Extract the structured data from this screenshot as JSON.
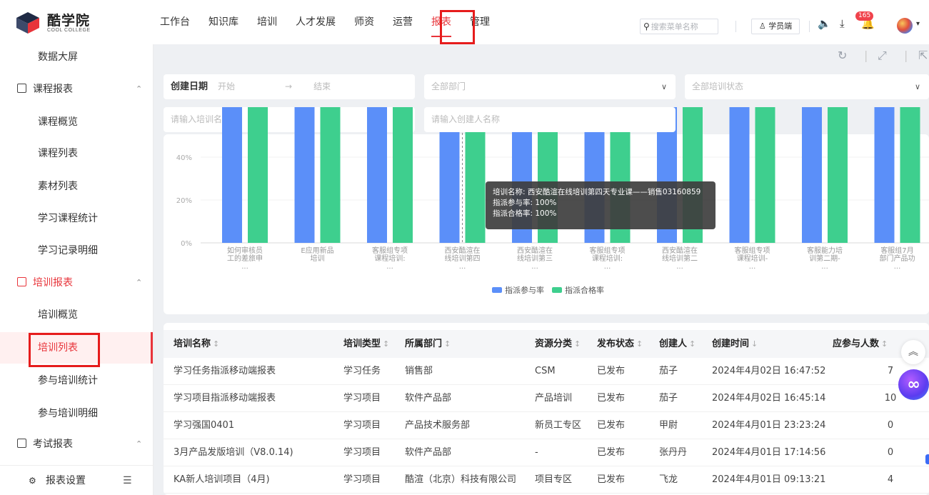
{
  "app": {
    "name": "酷学院",
    "sub": "COOL COLLEGE"
  },
  "nav": [
    {
      "label": "工作台"
    },
    {
      "label": "知识库"
    },
    {
      "label": "培训"
    },
    {
      "label": "人才发展"
    },
    {
      "label": "师资"
    },
    {
      "label": "运营"
    },
    {
      "label": "报表",
      "active": true
    },
    {
      "label": "管理"
    }
  ],
  "header": {
    "search_placeholder": "搜索菜单名称",
    "role_label": "学员端",
    "notification_count": "165"
  },
  "sidebar": {
    "items": [
      {
        "label": "数据大屏",
        "type": "sub"
      },
      {
        "label": "课程报表",
        "type": "group"
      },
      {
        "label": "课程概览",
        "type": "sub"
      },
      {
        "label": "课程列表",
        "type": "sub"
      },
      {
        "label": "素材列表",
        "type": "sub"
      },
      {
        "label": "学习课程统计",
        "type": "sub"
      },
      {
        "label": "学习记录明细",
        "type": "sub"
      },
      {
        "label": "培训报表",
        "type": "group",
        "active": true
      },
      {
        "label": "培训概览",
        "type": "sub"
      },
      {
        "label": "培训列表",
        "type": "sub",
        "active": true
      },
      {
        "label": "参与培训统计",
        "type": "sub"
      },
      {
        "label": "参与培训明细",
        "type": "sub"
      },
      {
        "label": "考试报表",
        "type": "group"
      }
    ],
    "settings_label": "报表设置"
  },
  "filters": {
    "date_label": "创建日期",
    "date_start": "开始",
    "date_end": "结束",
    "department": "全部部门",
    "status": "全部培训状态",
    "name_placeholder": "请输入培训名称",
    "creator_placeholder": "请输入创建人名称"
  },
  "chart_data": {
    "type": "bar",
    "categories": [
      "如何审核员工的差旅申...",
      "E应用新品培训",
      "客服组专项课程培训:...",
      "西安酷渲在线培训第四...",
      "西安酷渲在线培训第三...",
      "客服组专项课程培训:...",
      "西安酷渲在线培训第二...",
      "客服组专项课程培训-...",
      "客服能力培训第二期-...",
      "客服组7月部门产品功..."
    ],
    "tick_lines": [
      [
        "如何审核员",
        "工的差旅申",
        "..."
      ],
      [
        "E应用新品",
        "培训",
        ""
      ],
      [
        "客服组专项",
        "课程培训:",
        "..."
      ],
      [
        "西安酷渲在",
        "线培训第四",
        "..."
      ],
      [
        "西安酷渲在",
        "线培训第三",
        "..."
      ],
      [
        "客服组专项",
        "课程培训:",
        "..."
      ],
      [
        "西安酷渲在",
        "线培训第二",
        "..."
      ],
      [
        "客服组专项",
        "课程培训-",
        "..."
      ],
      [
        "客服能力培",
        "训第二期-",
        "..."
      ],
      [
        "客服组7月",
        "部门产品功",
        "..."
      ]
    ],
    "series": [
      {
        "name": "指派参与率",
        "color": "#5b8ff9",
        "values": [
          100,
          100,
          100,
          100,
          100,
          100,
          100,
          100,
          100,
          100
        ]
      },
      {
        "name": "指派合格率",
        "color": "#3ecf8e",
        "values": [
          100,
          100,
          100,
          100,
          100,
          100,
          100,
          100,
          100,
          100
        ]
      }
    ],
    "y_ticks": [
      "0%",
      "20%",
      "40%"
    ],
    "ylim": [
      0,
      100
    ],
    "legend": "bottom-center"
  },
  "tooltip": {
    "line1": "培训名称: 西安酷渲在线培训第四天专业课——销售03160859",
    "line2": "指派参与率: 100%",
    "line3": "指派合格率: 100%"
  },
  "table": {
    "columns": [
      "培训名称",
      "培训类型",
      "所属部门",
      "资源分类",
      "发布状态",
      "创建人",
      "创建时间",
      "应参与人数"
    ],
    "rows": [
      [
        "学习任务指派移动端报表",
        "学习任务",
        "销售部",
        "CSM",
        "已发布",
        "茄子",
        "2024年4月02日 16:47:52",
        "7"
      ],
      [
        "学习项目指派移动端报表",
        "学习项目",
        "软件产品部",
        "产品培训",
        "已发布",
        "茄子",
        "2024年4月02日 16:45:14",
        "10"
      ],
      [
        "学习强国0401",
        "学习项目",
        "产品技术服务部",
        "新员工专区",
        "已发布",
        "甲尉",
        "2024年4月01日 23:23:24",
        "0"
      ],
      [
        "3月产品发版培训（V8.0.14)",
        "学习项目",
        "软件产品部",
        "-",
        "已发布",
        "张丹丹",
        "2024年4月01日 17:14:56",
        "0"
      ],
      [
        "KA新人培训项目（4月)",
        "学习项目",
        "酷渲（北京）科技有限公司",
        "项目专区",
        "已发布",
        "飞龙",
        "2024年4月01日 09:13:21",
        "4"
      ]
    ]
  },
  "colors": {
    "accent": "#e8343a",
    "highlight_box": "#e61c1c",
    "series1": "#5b8ff9",
    "series2": "#3ecf8e"
  }
}
